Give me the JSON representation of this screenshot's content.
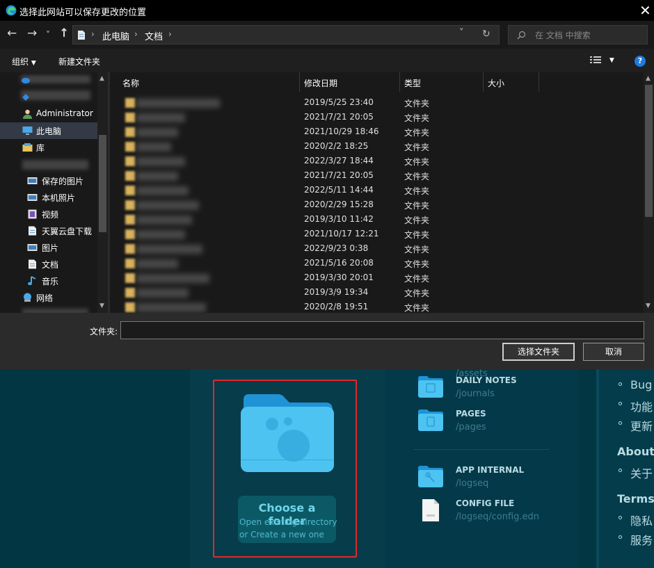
{
  "dialog": {
    "title": "选择此网站可以保存更改的位置",
    "nav": {
      "back": "←",
      "forward": "→",
      "recent": "˅",
      "up": "↑",
      "refresh": "↻",
      "dropdown": "˅"
    },
    "breadcrumb": [
      "此电脑",
      "文档"
    ],
    "search_placeholder": "在 文档 中搜索",
    "toolbar": {
      "organize": "组织",
      "new_folder": "新建文件夹",
      "help": "?"
    },
    "tree": [
      {
        "label": "Administrator",
        "icon": "user-icon"
      },
      {
        "label": "此电脑",
        "icon": "computer-icon",
        "selected": true
      },
      {
        "label": "库",
        "icon": "library-icon"
      },
      {
        "label": "保存的图片",
        "icon": "pictures-icon"
      },
      {
        "label": "本机照片",
        "icon": "pictures-icon"
      },
      {
        "label": "视频",
        "icon": "video-icon"
      },
      {
        "label": "天翼云盘下载",
        "icon": "document-icon"
      },
      {
        "label": "图片",
        "icon": "pictures-icon"
      },
      {
        "label": "文档",
        "icon": "document-icon"
      },
      {
        "label": "音乐",
        "icon": "music-icon"
      },
      {
        "label": "网络",
        "icon": "network-icon"
      }
    ],
    "columns": {
      "name": "名称",
      "modified": "修改日期",
      "type": "类型",
      "size": "大小"
    },
    "rows": [
      {
        "date": "2019/5/25 23:40",
        "type": "文件夹"
      },
      {
        "date": "2021/7/21 20:05",
        "type": "文件夹"
      },
      {
        "date": "2021/10/29 18:46",
        "type": "文件夹"
      },
      {
        "date": "2020/2/2 18:25",
        "type": "文件夹"
      },
      {
        "date": "2022/3/27 18:44",
        "type": "文件夹"
      },
      {
        "date": "2021/7/21 20:05",
        "type": "文件夹"
      },
      {
        "date": "2022/5/11 14:44",
        "type": "文件夹"
      },
      {
        "date": "2020/2/29 15:28",
        "type": "文件夹"
      },
      {
        "date": "2019/3/10 11:42",
        "type": "文件夹"
      },
      {
        "date": "2021/10/17 12:21",
        "type": "文件夹"
      },
      {
        "date": "2022/9/23 0:38",
        "type": "文件夹"
      },
      {
        "date": "2021/5/16 20:08",
        "type": "文件夹"
      },
      {
        "date": "2019/3/30 20:01",
        "type": "文件夹"
      },
      {
        "date": "2019/3/9 19:34",
        "type": "文件夹"
      },
      {
        "date": "2020/2/8 19:51",
        "type": "文件夹"
      }
    ],
    "folder_label": "文件夹:",
    "folder_value": "",
    "select_button": "选择文件夹",
    "cancel_button": "取消"
  },
  "app": {
    "choose": {
      "title": "Choose a folder",
      "line1": "Open existing directory",
      "line2": "or Create a new one"
    },
    "dirs": [
      {
        "name": "",
        "path": "/assets"
      },
      {
        "name": "DAILY NOTES",
        "path": "/journals"
      },
      {
        "name": "PAGES",
        "path": "/pages"
      },
      {
        "name": "APP INTERNAL",
        "path": "/logseq"
      },
      {
        "name": "CONFIG FILE",
        "path": "/logseq/config.edn"
      }
    ],
    "right": {
      "items_1": [
        "Bug",
        "功能",
        "更新"
      ],
      "about": "About",
      "items_2": [
        "关于"
      ],
      "terms": "Terms",
      "items_3": [
        "隐私",
        "服务"
      ]
    }
  }
}
